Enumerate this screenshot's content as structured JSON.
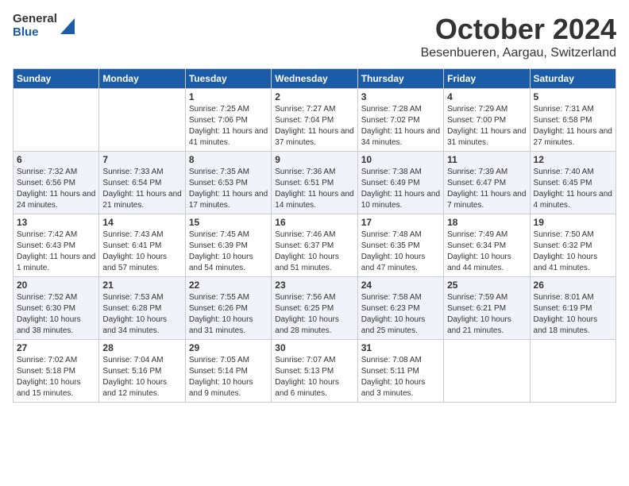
{
  "header": {
    "logo": {
      "general": "General",
      "blue": "Blue"
    },
    "month": "October 2024",
    "location": "Besenbueren, Aargau, Switzerland"
  },
  "days_of_week": [
    "Sunday",
    "Monday",
    "Tuesday",
    "Wednesday",
    "Thursday",
    "Friday",
    "Saturday"
  ],
  "weeks": [
    [
      {
        "day": "",
        "info": ""
      },
      {
        "day": "",
        "info": ""
      },
      {
        "day": "1",
        "info": "Sunrise: 7:25 AM\nSunset: 7:06 PM\nDaylight: 11 hours and 41 minutes."
      },
      {
        "day": "2",
        "info": "Sunrise: 7:27 AM\nSunset: 7:04 PM\nDaylight: 11 hours and 37 minutes."
      },
      {
        "day": "3",
        "info": "Sunrise: 7:28 AM\nSunset: 7:02 PM\nDaylight: 11 hours and 34 minutes."
      },
      {
        "day": "4",
        "info": "Sunrise: 7:29 AM\nSunset: 7:00 PM\nDaylight: 11 hours and 31 minutes."
      },
      {
        "day": "5",
        "info": "Sunrise: 7:31 AM\nSunset: 6:58 PM\nDaylight: 11 hours and 27 minutes."
      }
    ],
    [
      {
        "day": "6",
        "info": "Sunrise: 7:32 AM\nSunset: 6:56 PM\nDaylight: 11 hours and 24 minutes."
      },
      {
        "day": "7",
        "info": "Sunrise: 7:33 AM\nSunset: 6:54 PM\nDaylight: 11 hours and 21 minutes."
      },
      {
        "day": "8",
        "info": "Sunrise: 7:35 AM\nSunset: 6:53 PM\nDaylight: 11 hours and 17 minutes."
      },
      {
        "day": "9",
        "info": "Sunrise: 7:36 AM\nSunset: 6:51 PM\nDaylight: 11 hours and 14 minutes."
      },
      {
        "day": "10",
        "info": "Sunrise: 7:38 AM\nSunset: 6:49 PM\nDaylight: 11 hours and 10 minutes."
      },
      {
        "day": "11",
        "info": "Sunrise: 7:39 AM\nSunset: 6:47 PM\nDaylight: 11 hours and 7 minutes."
      },
      {
        "day": "12",
        "info": "Sunrise: 7:40 AM\nSunset: 6:45 PM\nDaylight: 11 hours and 4 minutes."
      }
    ],
    [
      {
        "day": "13",
        "info": "Sunrise: 7:42 AM\nSunset: 6:43 PM\nDaylight: 11 hours and 1 minute."
      },
      {
        "day": "14",
        "info": "Sunrise: 7:43 AM\nSunset: 6:41 PM\nDaylight: 10 hours and 57 minutes."
      },
      {
        "day": "15",
        "info": "Sunrise: 7:45 AM\nSunset: 6:39 PM\nDaylight: 10 hours and 54 minutes."
      },
      {
        "day": "16",
        "info": "Sunrise: 7:46 AM\nSunset: 6:37 PM\nDaylight: 10 hours and 51 minutes."
      },
      {
        "day": "17",
        "info": "Sunrise: 7:48 AM\nSunset: 6:35 PM\nDaylight: 10 hours and 47 minutes."
      },
      {
        "day": "18",
        "info": "Sunrise: 7:49 AM\nSunset: 6:34 PM\nDaylight: 10 hours and 44 minutes."
      },
      {
        "day": "19",
        "info": "Sunrise: 7:50 AM\nSunset: 6:32 PM\nDaylight: 10 hours and 41 minutes."
      }
    ],
    [
      {
        "day": "20",
        "info": "Sunrise: 7:52 AM\nSunset: 6:30 PM\nDaylight: 10 hours and 38 minutes."
      },
      {
        "day": "21",
        "info": "Sunrise: 7:53 AM\nSunset: 6:28 PM\nDaylight: 10 hours and 34 minutes."
      },
      {
        "day": "22",
        "info": "Sunrise: 7:55 AM\nSunset: 6:26 PM\nDaylight: 10 hours and 31 minutes."
      },
      {
        "day": "23",
        "info": "Sunrise: 7:56 AM\nSunset: 6:25 PM\nDaylight: 10 hours and 28 minutes."
      },
      {
        "day": "24",
        "info": "Sunrise: 7:58 AM\nSunset: 6:23 PM\nDaylight: 10 hours and 25 minutes."
      },
      {
        "day": "25",
        "info": "Sunrise: 7:59 AM\nSunset: 6:21 PM\nDaylight: 10 hours and 21 minutes."
      },
      {
        "day": "26",
        "info": "Sunrise: 8:01 AM\nSunset: 6:19 PM\nDaylight: 10 hours and 18 minutes."
      }
    ],
    [
      {
        "day": "27",
        "info": "Sunrise: 7:02 AM\nSunset: 5:18 PM\nDaylight: 10 hours and 15 minutes."
      },
      {
        "day": "28",
        "info": "Sunrise: 7:04 AM\nSunset: 5:16 PM\nDaylight: 10 hours and 12 minutes."
      },
      {
        "day": "29",
        "info": "Sunrise: 7:05 AM\nSunset: 5:14 PM\nDaylight: 10 hours and 9 minutes."
      },
      {
        "day": "30",
        "info": "Sunrise: 7:07 AM\nSunset: 5:13 PM\nDaylight: 10 hours and 6 minutes."
      },
      {
        "day": "31",
        "info": "Sunrise: 7:08 AM\nSunset: 5:11 PM\nDaylight: 10 hours and 3 minutes."
      },
      {
        "day": "",
        "info": ""
      },
      {
        "day": "",
        "info": ""
      }
    ]
  ]
}
